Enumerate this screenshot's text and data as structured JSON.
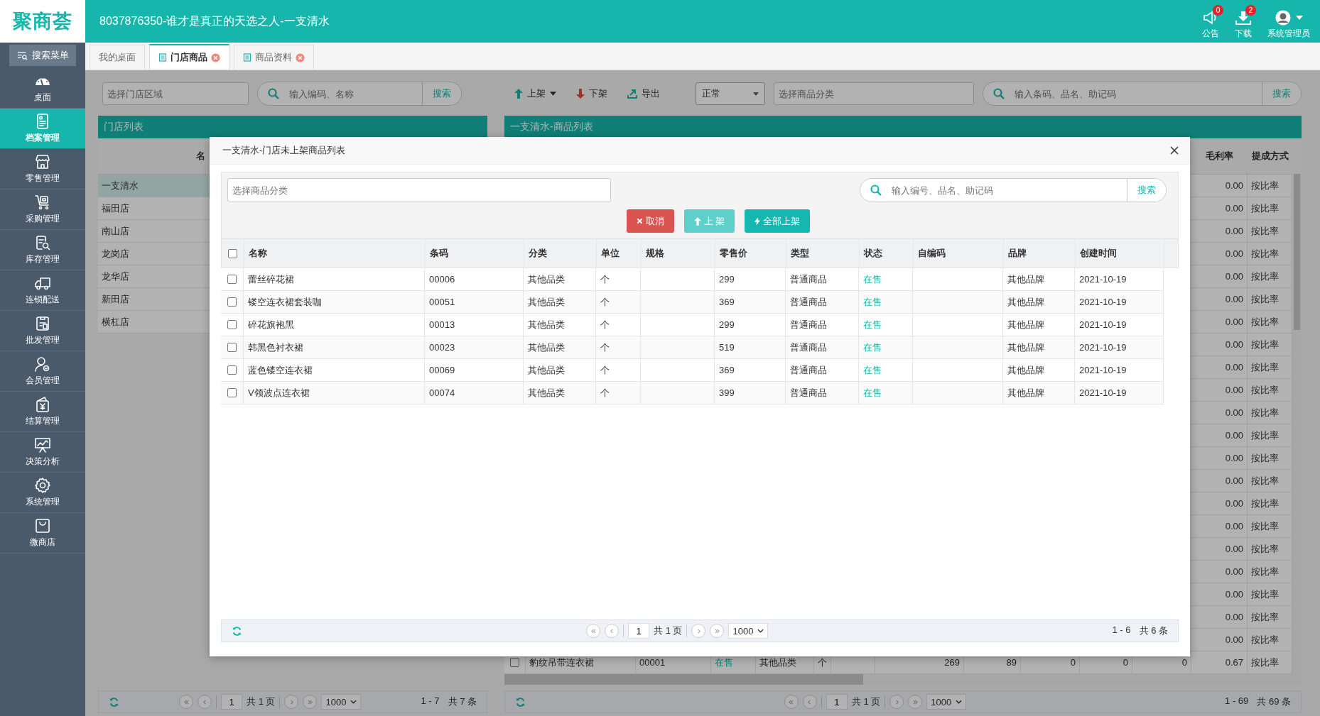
{
  "app": {
    "logo": "聚商荟",
    "title": "8037876350-谁才是真正的天选之人-一支清水"
  },
  "header_actions": [
    {
      "kind": "announcement",
      "label": "公告",
      "badge": "0"
    },
    {
      "kind": "download",
      "label": "下载",
      "badge": "2"
    },
    {
      "kind": "user",
      "label": "系统管理员"
    }
  ],
  "sidebar": {
    "search_button": "搜索菜单",
    "items": [
      {
        "label": "桌面",
        "selected": false
      },
      {
        "label": "档案管理",
        "selected": true
      },
      {
        "label": "零售管理",
        "selected": false
      },
      {
        "label": "采购管理",
        "selected": false
      },
      {
        "label": "库存管理",
        "selected": false
      },
      {
        "label": "连锁配送",
        "selected": false
      },
      {
        "label": "批发管理",
        "selected": false
      },
      {
        "label": "会员管理",
        "selected": false
      },
      {
        "label": "结算管理",
        "selected": false
      },
      {
        "label": "决策分析",
        "selected": false
      },
      {
        "label": "系统管理",
        "selected": false
      },
      {
        "label": "微商店",
        "selected": false
      }
    ]
  },
  "tabs": [
    {
      "label": "我的桌面",
      "selected": false,
      "closable": false
    },
    {
      "label": "门店商品",
      "selected": true,
      "closable": true
    },
    {
      "label": "商品资料",
      "selected": false,
      "closable": true
    }
  ],
  "store_panel": {
    "area_placeholder": "选择门店区域",
    "search_placeholder": "输入编码、名称",
    "search_button": "搜索",
    "title": "门店列表",
    "column": "名",
    "stores": [
      {
        "name": "一支清水",
        "selected": true
      },
      {
        "name": "福田店",
        "selected": false
      },
      {
        "name": "南山店",
        "selected": false
      },
      {
        "name": "龙岗店",
        "selected": false
      },
      {
        "name": "龙华店",
        "selected": false
      },
      {
        "name": "新田店",
        "selected": false
      },
      {
        "name": "横杠店",
        "selected": false
      }
    ],
    "pager": {
      "page": "1",
      "pages": "共 1 页",
      "page_size": "1000",
      "range": "1 - 7",
      "total": "共 7 条"
    }
  },
  "product_panel": {
    "toolbar": [
      {
        "kind": "up",
        "label": "上架",
        "dropdown": true
      },
      {
        "kind": "down",
        "label": "下架",
        "dropdown": false
      },
      {
        "kind": "export",
        "label": "导出",
        "dropdown": false
      }
    ],
    "status_select": "正常",
    "category_placeholder": "选择商品分类",
    "search_placeholder": "输入条码、品名、助记码",
    "search_button": "搜索",
    "title": "一支清水-商品列表",
    "columns": [
      "毛利率",
      "提成方式"
    ],
    "rows": [
      [
        "0.00",
        "按比率"
      ],
      [
        "0.00",
        "按比率"
      ],
      [
        "0.00",
        "按比率"
      ],
      [
        "0.00",
        "按比率"
      ],
      [
        "0.00",
        "按比率"
      ],
      [
        "0.00",
        "按比率"
      ],
      [
        "0.00",
        "按比率"
      ],
      [
        "0.00",
        "按比率"
      ],
      [
        "0.00",
        "按比率"
      ],
      [
        "0.00",
        "按比率"
      ],
      [
        "0.00",
        "按比率"
      ],
      [
        "0.00",
        "按比率"
      ],
      [
        "0.00",
        "按比率"
      ],
      [
        "0.00",
        "按比率"
      ],
      [
        "0.00",
        "按比率"
      ],
      [
        "0.00",
        "按比率"
      ],
      [
        "0.00",
        "按比率"
      ],
      [
        "0.00",
        "按比率"
      ],
      [
        "0.00",
        "按比率"
      ],
      [
        "0.00",
        "按比率"
      ],
      [
        "0.00",
        "按比率"
      ]
    ],
    "full_row": {
      "checked": false,
      "name": "豹纹吊带连衣裙",
      "code": "00001",
      "status": "在售",
      "category": "其他品类",
      "unit": "个",
      "numbers": [
        "269",
        "89",
        "0",
        "0",
        "0",
        "0.67"
      ],
      "commission": "按比率"
    },
    "pager": {
      "page": "1",
      "pages": "共 1 页",
      "page_size": "1000",
      "range": "1 - 69",
      "total": "共 69 条"
    }
  },
  "dialog": {
    "title": "一支清水-门店未上架商品列表",
    "category_placeholder": "选择商品分类",
    "search_placeholder": "输入编号、品名、助记码",
    "search_button": "搜索",
    "buttons": [
      {
        "kind": "cancel",
        "label": "取消"
      },
      {
        "kind": "up",
        "label": "上 架"
      },
      {
        "kind": "all",
        "label": "全部上架"
      }
    ],
    "select_all": false,
    "columns": [
      "名称",
      "条码",
      "分类",
      "单位",
      "规格",
      "零售价",
      "类型",
      "状态",
      "自编码",
      "品牌",
      "创建时间"
    ],
    "rows": [
      {
        "checked": false,
        "cells": [
          "蕾丝碎花裙",
          "00006",
          "其他品类",
          "个",
          null,
          "299",
          "普通商品",
          "在售",
          null,
          "其他品牌",
          "2021-10-19"
        ]
      },
      {
        "checked": false,
        "cells": [
          "镂空连衣裙套装咖",
          "00051",
          "其他品类",
          "个",
          null,
          "369",
          "普通商品",
          "在售",
          null,
          "其他品牌",
          "2021-10-19"
        ]
      },
      {
        "checked": false,
        "cells": [
          "碎花旗袍黑",
          "00013",
          "其他品类",
          "个",
          null,
          "299",
          "普通商品",
          "在售",
          null,
          "其他品牌",
          "2021-10-19"
        ]
      },
      {
        "checked": false,
        "cells": [
          "韩黑色衬衣裙",
          "00023",
          "其他品类",
          "个",
          null,
          "519",
          "普通商品",
          "在售",
          null,
          "其他品牌",
          "2021-10-19"
        ]
      },
      {
        "checked": false,
        "cells": [
          "蓝色镂空连衣裙",
          "00069",
          "其他品类",
          "个",
          null,
          "369",
          "普通商品",
          "在售",
          null,
          "其他品牌",
          "2021-10-19"
        ]
      },
      {
        "checked": false,
        "cells": [
          "V领波点连衣裙",
          "00074",
          "其他品类",
          "个",
          null,
          "399",
          "普通商品",
          "在售",
          null,
          "其他品牌",
          "2021-10-19"
        ]
      }
    ],
    "pager": {
      "page": "1",
      "pages": "共 1 页",
      "page_size": "1000",
      "range": "1 - 6",
      "total": "共 6 条"
    }
  }
}
